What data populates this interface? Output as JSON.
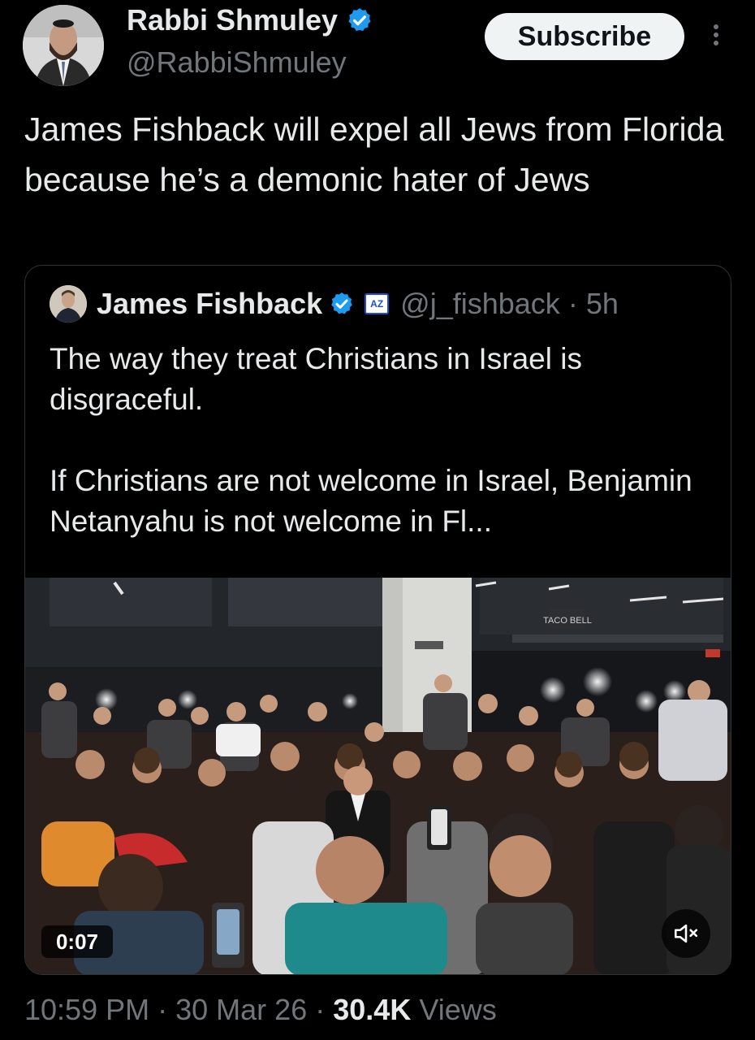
{
  "author": {
    "display_name": "Rabbi Shmuley",
    "handle": "@RabbiShmuley",
    "verified": true
  },
  "actions": {
    "subscribe_label": "Subscribe"
  },
  "tweet": {
    "text": "James Fishback will expel all Jews from Florida because he’s a demonic hater of Jews"
  },
  "quoted": {
    "display_name": "James Fishback",
    "verified": true,
    "affiliate_badge": "AZ",
    "handle": "@j_fishback",
    "separator": "·",
    "age": "5h",
    "text": "The way they treat Christians in Israel is disgraceful.\n\nIf Christians are not welcome in Israel, Benjamin Netanyahu is not welcome in Fl...",
    "video": {
      "duration": "0:07",
      "muted": true,
      "sign_text": "TACO BELL"
    }
  },
  "meta": {
    "time": "10:59 PM",
    "date": "30 Mar 26",
    "separator": "·",
    "views_count": "30.4K",
    "views_label": "Views"
  },
  "colors": {
    "background": "#000000",
    "text": "#e7e9ea",
    "secondary": "#71767b",
    "verified_blue": "#1d9bf0"
  },
  "icons": [
    "verified-badge-icon",
    "more-options-icon",
    "affiliate-badge-icon",
    "mute-icon"
  ]
}
